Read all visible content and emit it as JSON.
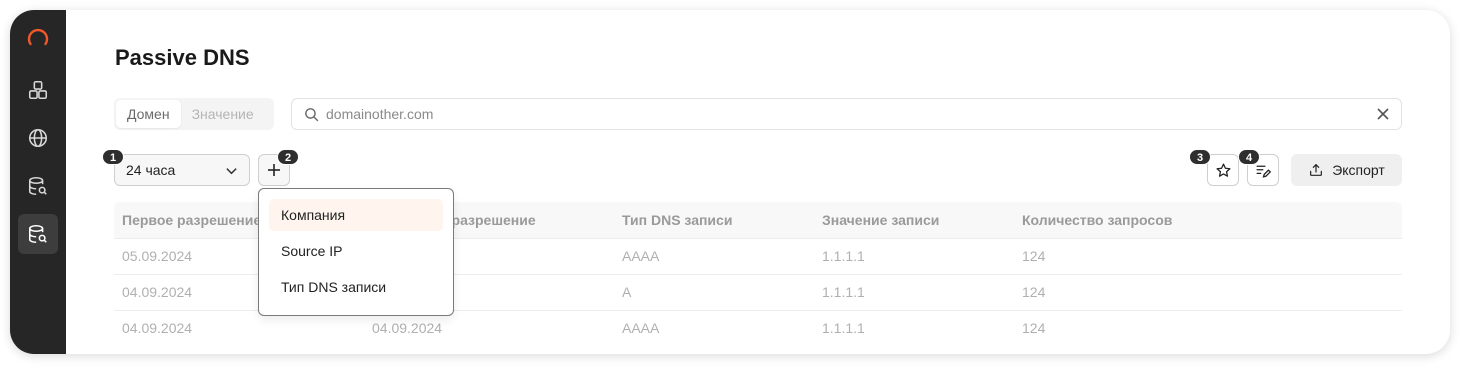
{
  "page": {
    "title": "Passive DNS"
  },
  "sidebar": {
    "logo": "ring-logo-icon",
    "items": [
      {
        "icon": "blocks-icon",
        "active": false
      },
      {
        "icon": "globe-icon",
        "active": false
      },
      {
        "icon": "database-search-icon",
        "active": false
      },
      {
        "icon": "database-search-icon",
        "active": true
      }
    ]
  },
  "search_mode": {
    "options": [
      "Домен",
      "Значение"
    ],
    "selected": "Домен"
  },
  "search": {
    "value": "domainother.com",
    "placeholder": "domainother.com"
  },
  "filters": {
    "period": "24 часа",
    "period_badge": "1",
    "add_badge": "2",
    "favorite_badge": "3",
    "columns_badge": "4"
  },
  "toolbar": {
    "export_label": "Экспорт"
  },
  "dropdown": {
    "items": [
      "Компания",
      "Source IP",
      "Тип DNS записи"
    ],
    "highlighted": "Компания"
  },
  "table": {
    "headers": [
      "Первое разрешение",
      "Последнее разрешение",
      "Тип DNS записи",
      "Значение записи",
      "Количество запросов"
    ],
    "rows": [
      [
        "05.09.2024",
        "",
        "AAAA",
        "1.1.1.1",
        "124"
      ],
      [
        "04.09.2024",
        "",
        "A",
        "1.1.1.1",
        "124"
      ],
      [
        "04.09.2024",
        "04.09.2024",
        "AAAA",
        "1.1.1.1",
        "124"
      ]
    ]
  },
  "colors": {
    "sidebar": "#262626",
    "logo_accent": "#f0582c",
    "highlight": "#fff5ee"
  }
}
